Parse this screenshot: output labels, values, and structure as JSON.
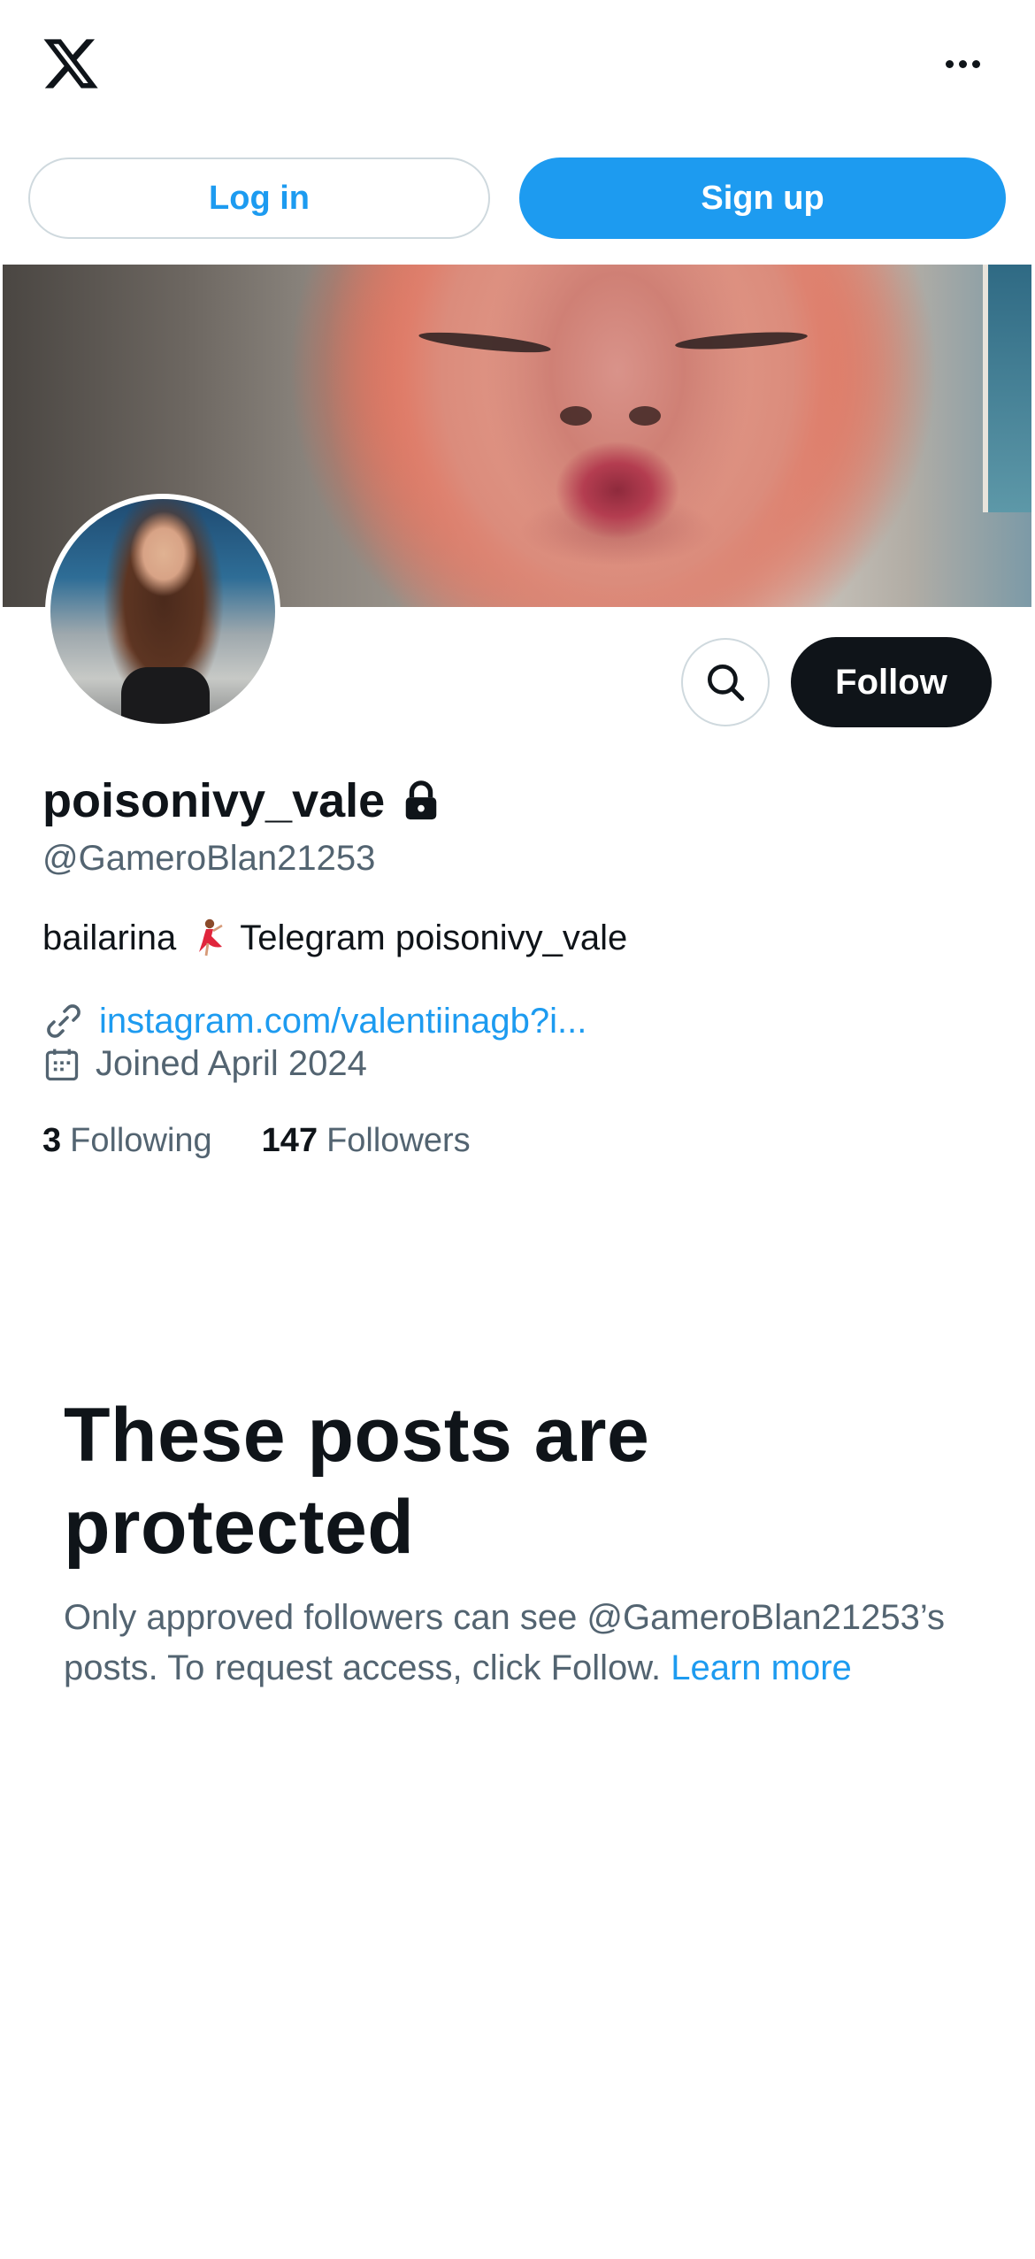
{
  "header": {
    "logo_icon": "x-logo-icon",
    "more_icon": "more-horizontal-icon"
  },
  "auth": {
    "login_label": "Log in",
    "signup_label": "Sign up"
  },
  "profile": {
    "follow_label": "Follow",
    "display_name": "poisonivy_vale",
    "handle": "@GameroBlan21253",
    "bio_prefix": "bailarina",
    "bio_emoji": "dancer-emoji",
    "bio_suffix": "Telegram poisonivy_vale",
    "website": "instagram.com/valentiinagb?i...",
    "joined": "Joined April 2024",
    "following_count": "3",
    "following_label": "Following",
    "followers_count": "147",
    "followers_label": "Followers"
  },
  "protected": {
    "title": "These posts are protected",
    "body": "Only approved followers can see @GameroBlan21253’s posts. To request access, click Follow.",
    "learn_more": "Learn more"
  },
  "colors": {
    "accent": "#1d9bf0",
    "text_primary": "#0f1419",
    "text_secondary": "#536471",
    "border": "#cfd9de"
  }
}
